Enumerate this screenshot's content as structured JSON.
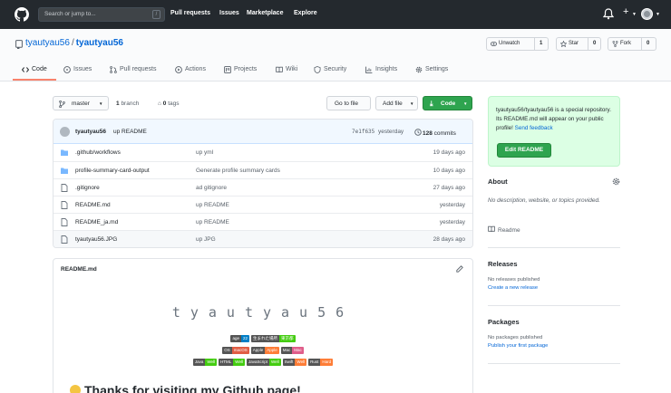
{
  "header": {
    "search_placeholder": "Search or jump to...",
    "search_key": "/",
    "nav": [
      "Pull requests",
      "Issues",
      "Marketplace",
      "Explore"
    ]
  },
  "repo": {
    "owner": "tyautyau56",
    "separator": "/",
    "name": "tyautyau56",
    "unwatch_label": "Unwatch",
    "unwatch_count": "1",
    "star_label": "Star",
    "star_count": "0",
    "fork_label": "Fork",
    "fork_count": "0"
  },
  "tabs": [
    "Code",
    "Issues",
    "Pull requests",
    "Actions",
    "Projects",
    "Wiki",
    "Security",
    "Insights",
    "Settings"
  ],
  "branch_bar": {
    "branch": "master",
    "branches_count": "1",
    "branches_label": "branch",
    "tags_count": "0",
    "tags_label": "tags",
    "goto_file": "Go to file",
    "add_file": "Add file",
    "code": "Code"
  },
  "latest_commit": {
    "user": "tyautyau56",
    "message": "up README",
    "sha": "7e1f635",
    "when": "yesterday",
    "count": "128",
    "count_label": "commits"
  },
  "files": [
    {
      "type": "dir",
      "name": ".github/workflows",
      "message": "up yml",
      "age": "19 days ago"
    },
    {
      "type": "dir",
      "name": "profile-summary-card-output",
      "message": "Generate profile summary cards",
      "age": "10 days ago"
    },
    {
      "type": "file",
      "name": ".gitignore",
      "message": "ad gitignore",
      "age": "27 days ago"
    },
    {
      "type": "file",
      "name": "README.md",
      "message": "up README",
      "age": "yesterday"
    },
    {
      "type": "file",
      "name": "README_ja.md",
      "message": "up README",
      "age": "yesterday"
    },
    {
      "type": "file",
      "name": "tyautyau56.JPG",
      "message": "up JPG",
      "age": "28 days ago"
    }
  ],
  "readme": {
    "title": "README.md",
    "spaced_name": "tyautyau56",
    "thanks": "Thanks for visiting my Github page!",
    "badges_row1": [
      {
        "label": "age",
        "value": "22",
        "color": "#007ec6"
      },
      {
        "label": "生まれた場所",
        "value": "東京都",
        "color": "#4c1"
      }
    ],
    "badges_row2": [
      {
        "label": "OS",
        "value": "macOS",
        "color": "#e05d44"
      },
      {
        "label": "Apple",
        "value": "Apple",
        "color": "#fe7d37"
      },
      {
        "label": "Mac",
        "value": "Mac",
        "color": "#e05d8a"
      }
    ],
    "badges_row3": [
      {
        "label": "Java",
        "value": "Well",
        "color": "#4c1"
      },
      {
        "label": "HTML",
        "value": "Well",
        "color": "#4c1"
      },
      {
        "label": "JavaScript",
        "value": "Well",
        "color": "#4c1"
      },
      {
        "label": "Swift",
        "value": "Well",
        "color": "#fe7d37"
      },
      {
        "label": "Rust",
        "value": "Hard",
        "color": "#fe7d37"
      }
    ]
  },
  "sidebar": {
    "special_text": "tyautyau56/tyautyau56 is a special repository. Its README.md will appear on your public profile!",
    "special_link": "Send feedback",
    "edit_readme": "Edit README",
    "about_title": "About",
    "about_desc": "No description, website, or topics provided.",
    "readme_link": "Readme",
    "releases_title": "Releases",
    "releases_none": "No releases published",
    "releases_link": "Create a new release",
    "packages_title": "Packages",
    "packages_none": "No packages published",
    "packages_link": "Publish your first package"
  },
  "colors": {
    "header_bg": "#24292e",
    "link": "#0366d6",
    "primary_green": "#2ea44f",
    "active_tab": "#f9826c",
    "special_bg": "#dcffe4",
    "commit_bar": "#f1f8ff"
  },
  "icons": [
    "github-logo-icon",
    "bell-icon",
    "plus-icon",
    "repo-icon",
    "eye-icon",
    "star-icon",
    "fork-icon",
    "branch-icon",
    "tag-icon",
    "folder-icon",
    "file-icon",
    "clock-icon",
    "pencil-icon",
    "gear-icon",
    "book-icon"
  ]
}
